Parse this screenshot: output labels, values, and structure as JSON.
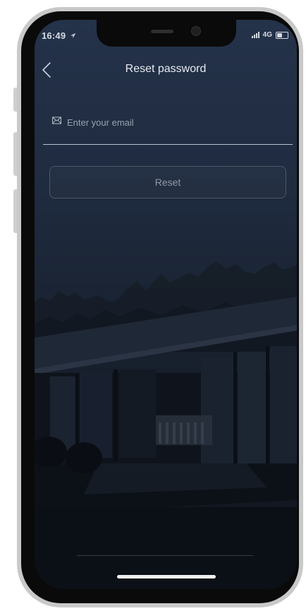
{
  "status_bar": {
    "time": "16:49",
    "network": "4G",
    "battery_level": 0.6
  },
  "nav": {
    "back_icon": "chevron-left-icon",
    "title": "Reset password"
  },
  "form": {
    "email": {
      "icon": "mail-icon",
      "value": "",
      "placeholder": "Enter your email"
    },
    "reset_label": "Reset"
  },
  "colors": {
    "screen_top": "#24324a",
    "screen_bottom": "#10151d",
    "text": "#e6eaf0",
    "button_border": "#4b586a"
  }
}
